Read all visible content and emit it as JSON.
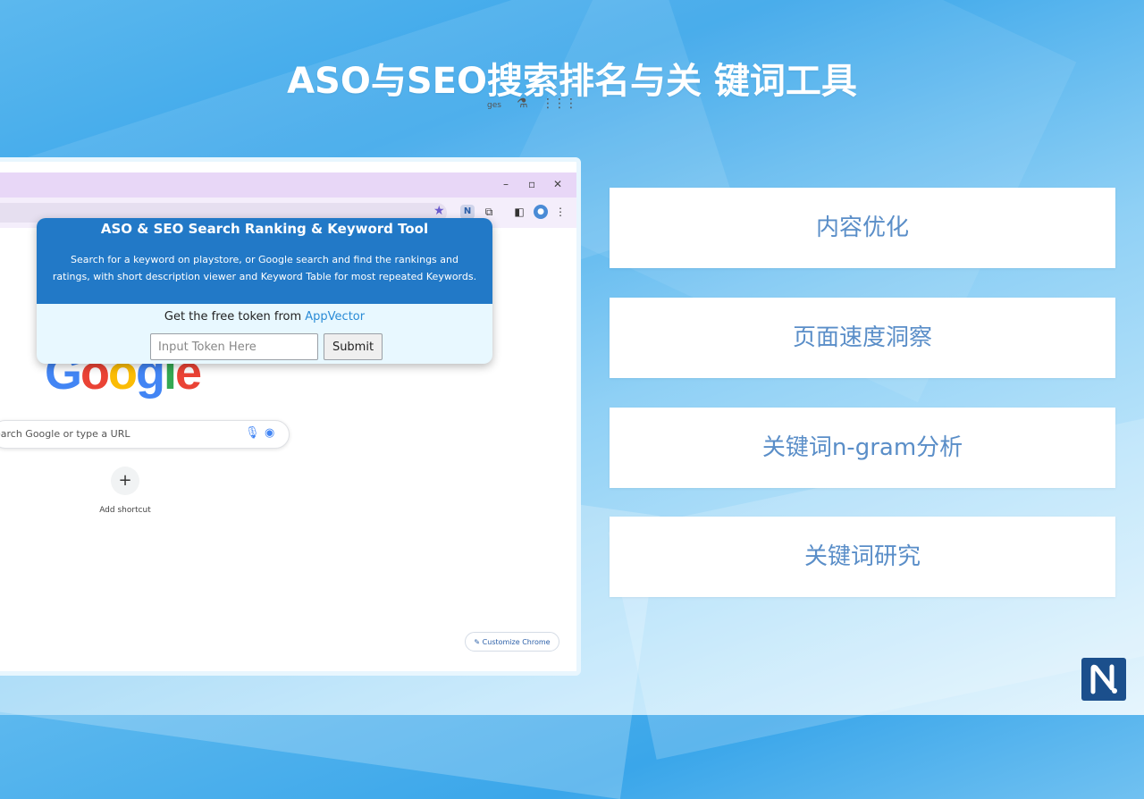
{
  "headline": "ASO与SEO搜索排名与关 键词工具",
  "browser": {
    "window_controls": {
      "minimize": "–",
      "restore": "▫",
      "close": "✕"
    },
    "images_link": "ges",
    "search_placeholder": "earch Google or type a URL",
    "add_shortcut_label": "Add shortcut",
    "customize_label": "Customize Chrome"
  },
  "popup": {
    "title": "ASO & SEO Search Ranking & Keyword Tool",
    "description": "Search for a keyword on playstore, or Google search and find the rankings and ratings, with short description viewer and Keyword Table for most repeated Keywords.",
    "token_prompt": "Get the free token from ",
    "token_link": "AppVector",
    "token_placeholder": "Input Token Here",
    "submit_label": "Submit"
  },
  "features": [
    {
      "label": "内容优化"
    },
    {
      "label": "页面速度洞察"
    },
    {
      "label": "关键词n-gram分析"
    },
    {
      "label": "关键词研究"
    }
  ],
  "colors": {
    "popup_header": "#2279c7",
    "feature_text": "#5a8ec8",
    "brand": "#1b4f8c"
  }
}
